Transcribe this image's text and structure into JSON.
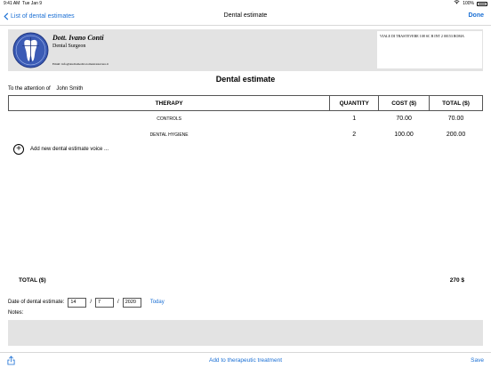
{
  "status_bar": {
    "time": "9:41 AM",
    "date": "Tue Jan 9",
    "battery": "100%"
  },
  "nav": {
    "back_label": "List of dental estimates",
    "title": "Dental estimate",
    "done_label": "Done"
  },
  "letterhead": {
    "doctor_name": "Dott. Ivano Conti",
    "doctor_role": "Dental Surgeon",
    "email": "Email: info@studiomedicoromastrastevere.it",
    "address": "VIALE DI TRASTEVERE 108 SC B INT 2 00153 ROMA"
  },
  "estimate": {
    "heading": "Dental estimate",
    "attention_label": "To the attention of",
    "patient_name": "John Smith",
    "columns": [
      "THERAPY",
      "QUANTITY",
      "COST ($)",
      "TOTAL ($)"
    ],
    "rows": [
      {
        "therapy": "CONTROLS",
        "quantity": "1",
        "cost": "70.00",
        "total": "70.00"
      },
      {
        "therapy": "DENTAL HYGIENE",
        "quantity": "2",
        "cost": "100.00",
        "total": "200.00"
      }
    ],
    "add_voice_label": "Add new dental estimate voice ...",
    "total_label": "TOTAL ($)",
    "total_value": "270 $"
  },
  "date": {
    "label": "Date of dental estimate:",
    "day": "14",
    "month": "7",
    "year": "2020",
    "separator": "/",
    "today_label": "Today"
  },
  "notes": {
    "label": "Notes:"
  },
  "toolbar": {
    "center_label": "Add to therapeutic treatment",
    "save_label": "Save"
  },
  "colors": {
    "accent": "#1a6fd4",
    "panel_gray": "#e3e3e3",
    "logo_blue": "#3b5bb5"
  },
  "icons": {
    "back": "chevron-left-icon",
    "share": "share-icon",
    "add": "plus-circle-icon",
    "logo": "tooth-logo-icon"
  }
}
